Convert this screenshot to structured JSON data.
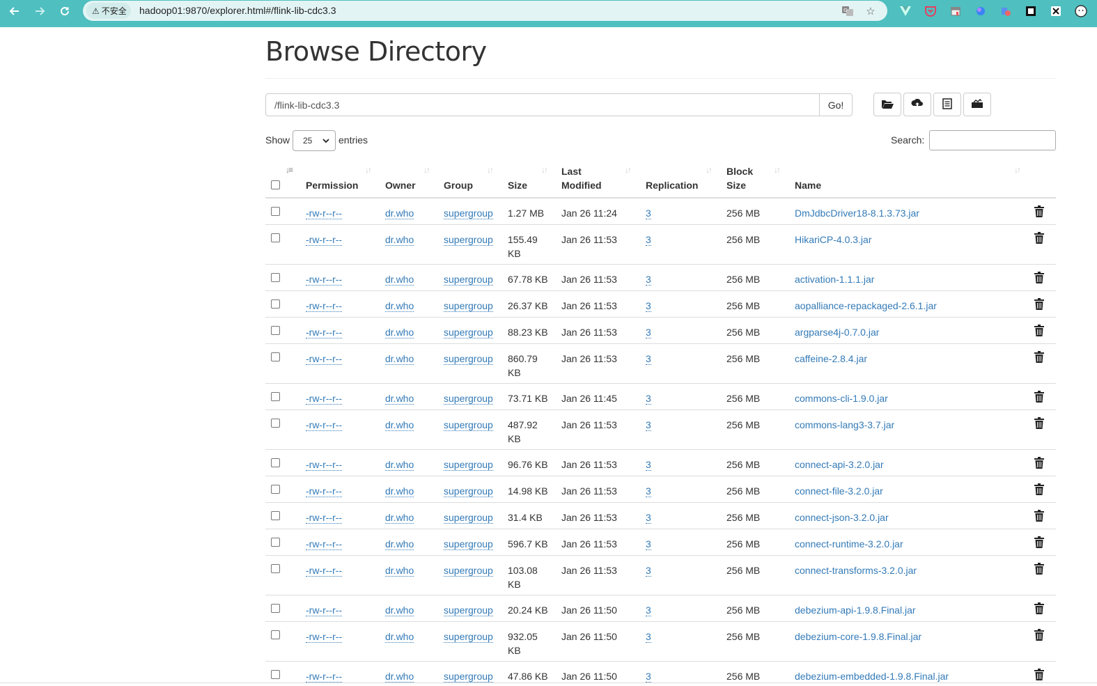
{
  "browser": {
    "security_label": "不安全",
    "url": "hadoop01:9870/explorer.html#/flink-lib-cdc3.3",
    "nav_icons": [
      "back-arrow-icon",
      "forward-arrow-icon",
      "reload-icon"
    ],
    "omnibox_icons": [
      "translate-icon",
      "bookmark-star-icon"
    ],
    "extension_icons": [
      "vue-devtools-icon",
      "pocket-icon",
      "store-icon",
      "browser-extension-icon",
      "pinned-extension-icon",
      "capture-icon",
      "x-extension-icon",
      "profile-icon"
    ],
    "accent": "#4fbfc0"
  },
  "page": {
    "title": "Browse Directory",
    "path_value": "/flink-lib-cdc3.3",
    "go_label": "Go!",
    "tool_icons": [
      "open-folder-icon",
      "upload-cloud-icon",
      "list-view-icon",
      "cut-paste-icon"
    ],
    "show_label": "Show",
    "entries_value": "25",
    "entries_label": "entries",
    "search_label": "Search:",
    "search_value": ""
  },
  "table": {
    "headers": {
      "permission": "Permission",
      "owner": "Owner",
      "group": "Group",
      "size": "Size",
      "last_modified_line1": "Last",
      "last_modified_line2": "Modified",
      "replication": "Replication",
      "block_size_line1": "Block",
      "block_size_line2": "Size",
      "name": "Name"
    },
    "rows": [
      {
        "permission": "-rw-r--r--",
        "owner": "dr.who",
        "group": "supergroup",
        "size": [
          "1.27 MB"
        ],
        "modified": "Jan 26 11:24",
        "replication": "3",
        "block_size": "256 MB",
        "name": "DmJdbcDriver18-8.1.3.73.jar"
      },
      {
        "permission": "-rw-r--r--",
        "owner": "dr.who",
        "group": "supergroup",
        "size": [
          "155.49",
          "KB"
        ],
        "modified": "Jan 26 11:53",
        "replication": "3",
        "block_size": "256 MB",
        "name": "HikariCP-4.0.3.jar"
      },
      {
        "permission": "-rw-r--r--",
        "owner": "dr.who",
        "group": "supergroup",
        "size": [
          "67.78 KB"
        ],
        "modified": "Jan 26 11:53",
        "replication": "3",
        "block_size": "256 MB",
        "name": "activation-1.1.1.jar"
      },
      {
        "permission": "-rw-r--r--",
        "owner": "dr.who",
        "group": "supergroup",
        "size": [
          "26.37 KB"
        ],
        "modified": "Jan 26 11:53",
        "replication": "3",
        "block_size": "256 MB",
        "name": "aopalliance-repackaged-2.6.1.jar"
      },
      {
        "permission": "-rw-r--r--",
        "owner": "dr.who",
        "group": "supergroup",
        "size": [
          "88.23 KB"
        ],
        "modified": "Jan 26 11:53",
        "replication": "3",
        "block_size": "256 MB",
        "name": "argparse4j-0.7.0.jar"
      },
      {
        "permission": "-rw-r--r--",
        "owner": "dr.who",
        "group": "supergroup",
        "size": [
          "860.79",
          "KB"
        ],
        "modified": "Jan 26 11:53",
        "replication": "3",
        "block_size": "256 MB",
        "name": "caffeine-2.8.4.jar"
      },
      {
        "permission": "-rw-r--r--",
        "owner": "dr.who",
        "group": "supergroup",
        "size": [
          "73.71 KB"
        ],
        "modified": "Jan 26 11:45",
        "replication": "3",
        "block_size": "256 MB",
        "name": "commons-cli-1.9.0.jar"
      },
      {
        "permission": "-rw-r--r--",
        "owner": "dr.who",
        "group": "supergroup",
        "size": [
          "487.92",
          "KB"
        ],
        "modified": "Jan 26 11:53",
        "replication": "3",
        "block_size": "256 MB",
        "name": "commons-lang3-3.7.jar"
      },
      {
        "permission": "-rw-r--r--",
        "owner": "dr.who",
        "group": "supergroup",
        "size": [
          "96.76 KB"
        ],
        "modified": "Jan 26 11:53",
        "replication": "3",
        "block_size": "256 MB",
        "name": "connect-api-3.2.0.jar"
      },
      {
        "permission": "-rw-r--r--",
        "owner": "dr.who",
        "group": "supergroup",
        "size": [
          "14.98 KB"
        ],
        "modified": "Jan 26 11:53",
        "replication": "3",
        "block_size": "256 MB",
        "name": "connect-file-3.2.0.jar"
      },
      {
        "permission": "-rw-r--r--",
        "owner": "dr.who",
        "group": "supergroup",
        "size": [
          "31.4 KB"
        ],
        "modified": "Jan 26 11:53",
        "replication": "3",
        "block_size": "256 MB",
        "name": "connect-json-3.2.0.jar"
      },
      {
        "permission": "-rw-r--r--",
        "owner": "dr.who",
        "group": "supergroup",
        "size": [
          "596.7 KB"
        ],
        "modified": "Jan 26 11:53",
        "replication": "3",
        "block_size": "256 MB",
        "name": "connect-runtime-3.2.0.jar"
      },
      {
        "permission": "-rw-r--r--",
        "owner": "dr.who",
        "group": "supergroup",
        "size": [
          "103.08",
          "KB"
        ],
        "modified": "Jan 26 11:53",
        "replication": "3",
        "block_size": "256 MB",
        "name": "connect-transforms-3.2.0.jar"
      },
      {
        "permission": "-rw-r--r--",
        "owner": "dr.who",
        "group": "supergroup",
        "size": [
          "20.24 KB"
        ],
        "modified": "Jan 26 11:50",
        "replication": "3",
        "block_size": "256 MB",
        "name": "debezium-api-1.9.8.Final.jar"
      },
      {
        "permission": "-rw-r--r--",
        "owner": "dr.who",
        "group": "supergroup",
        "size": [
          "932.05",
          "KB"
        ],
        "modified": "Jan 26 11:50",
        "replication": "3",
        "block_size": "256 MB",
        "name": "debezium-core-1.9.8.Final.jar"
      },
      {
        "permission": "-rw-r--r--",
        "owner": "dr.who",
        "group": "supergroup",
        "size": [
          "47.86 KB"
        ],
        "modified": "Jan 26 11:50",
        "replication": "3",
        "block_size": "256 MB",
        "name": "debezium-embedded-1.9.8.Final.jar"
      }
    ],
    "link_color": "#337ab7"
  }
}
